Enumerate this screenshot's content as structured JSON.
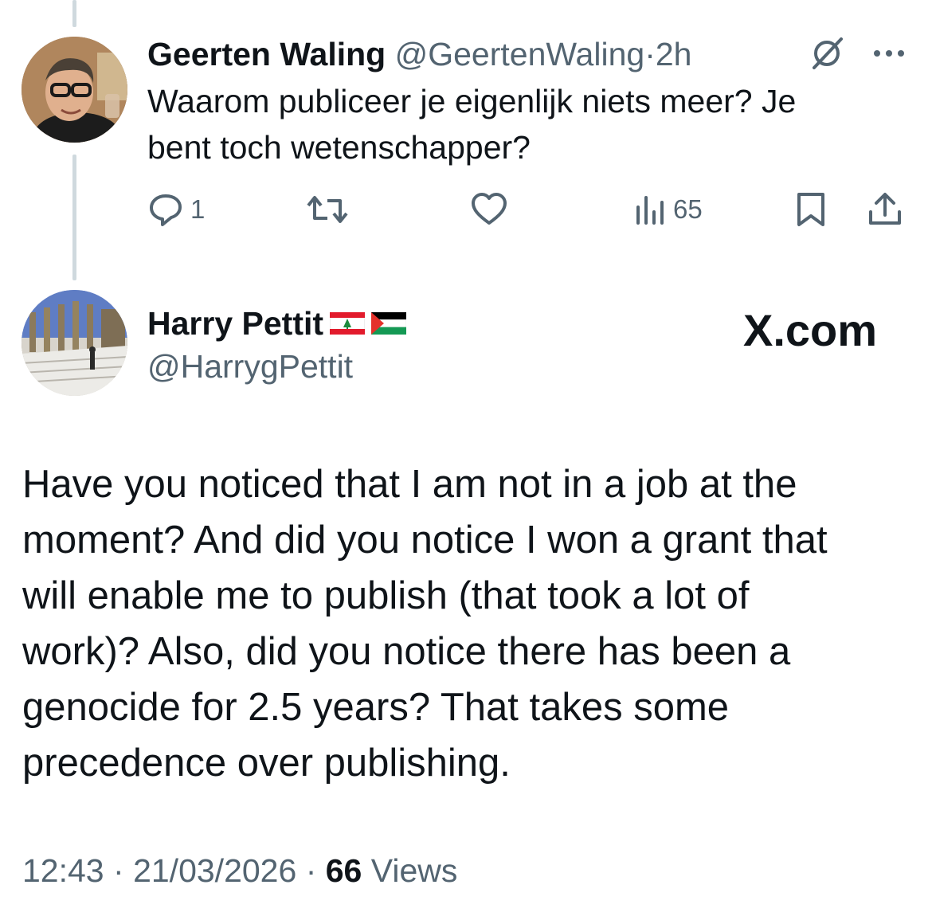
{
  "reply": {
    "name": "Geerten Waling",
    "handle": "@GeertenWaling",
    "separator": "·",
    "time": "2h",
    "text_line1": "Waarom publiceer je eigenlijk niets meer? Je",
    "text_line2": "bent toch wetenschapper?",
    "actions": {
      "reply_count": "1",
      "views_count": "65"
    },
    "icons": [
      "grok-icon",
      "more-icon",
      "reply-icon",
      "retweet-icon",
      "like-icon",
      "views-icon",
      "bookmark-icon",
      "share-icon"
    ]
  },
  "main": {
    "name": "Harry Pettit",
    "flags": [
      "lebanon-flag",
      "palestine-flag"
    ],
    "handle": "@HarrygPettit",
    "watermark": "X.com",
    "text_lines": [
      "Have you noticed that I am not in a job at the",
      "moment? And did you notice I won a grant that",
      "will enable me to publish (that took a lot of",
      "work)? Also, did you notice there has been a",
      "genocide for 2.5 years? That takes some",
      "precedence over publishing."
    ],
    "meta": {
      "time": "12:43",
      "sep1": "·",
      "date": "21/03/2026",
      "sep2": "·",
      "views": "66",
      "views_label": "Views"
    }
  },
  "colors": {
    "text": "#0f1419",
    "secondary": "#536471",
    "thread_line": "#cfd9de"
  }
}
